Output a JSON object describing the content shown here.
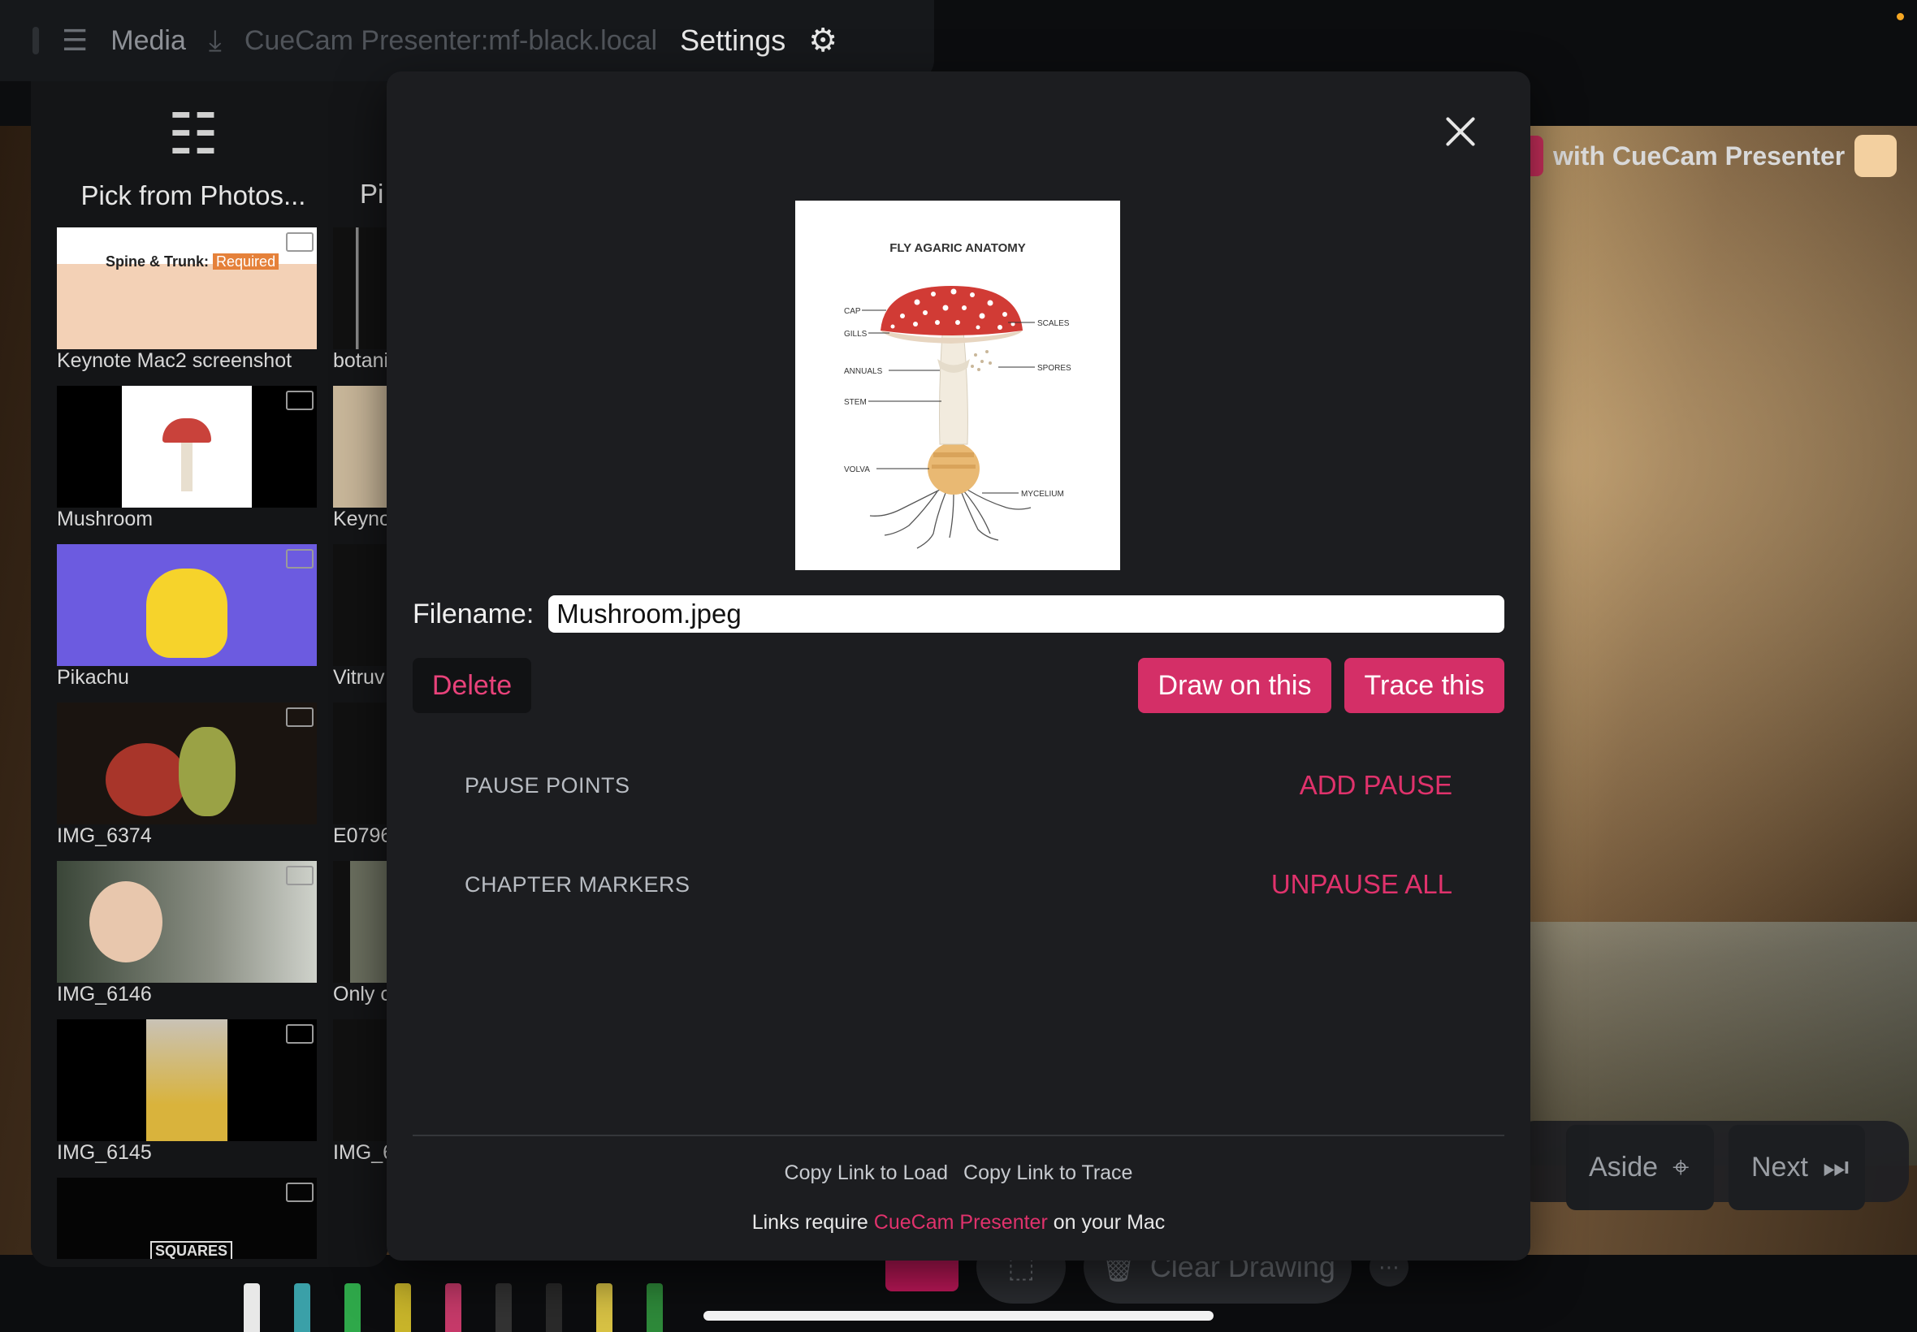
{
  "top_bar": {
    "media_label": "Media",
    "presenter_label": "CueCam Presenter:mf-black.local",
    "settings_label": "Settings"
  },
  "left_panel": {
    "pick_photos_label": "Pick from Photos...",
    "pick_other_label": "Pi",
    "col1": [
      {
        "caption": "Keynote Mac2 screenshot",
        "keynote_title": "Spine & Trunk:",
        "keynote_tag": "Required"
      },
      {
        "caption": "Mushroom"
      },
      {
        "caption": "Pikachu"
      },
      {
        "caption": "IMG_6374"
      },
      {
        "caption": "IMG_6146"
      },
      {
        "caption": "IMG_6145"
      },
      {
        "caption": "",
        "logo": "SQUARES"
      }
    ],
    "col2": [
      {
        "caption": "botani"
      },
      {
        "caption": "Keyno"
      },
      {
        "caption": "Vitruv"
      },
      {
        "caption": "E0796"
      },
      {
        "caption": "Only c"
      },
      {
        "caption": "IMG_6"
      }
    ]
  },
  "right_overlay": {
    "banner_text": "with CueCam Presenter",
    "aside_label": "Aside",
    "next_label": "Next",
    "clear_drawing_label": "Clear Drawing"
  },
  "modal": {
    "preview": {
      "title": "FLY AGARIC ANATOMY",
      "labels": {
        "cap": "CAP",
        "gills": "GILLS",
        "annuals": "ANNUALS",
        "stem": "STEM",
        "volva": "VOLVA",
        "scales": "SCALES",
        "spores": "SPORES",
        "mycelium": "MYCELIUM"
      }
    },
    "filename_label": "Filename:",
    "filename_value": "Mushroom.jpeg",
    "delete_label": "Delete",
    "draw_label": "Draw on this",
    "trace_label": "Trace this",
    "pause_points_label": "PAUSE POINTS",
    "add_pause_label": "ADD PAUSE",
    "chapter_markers_label": "CHAPTER MARKERS",
    "unpause_all_label": "UNPAUSE ALL",
    "copy_link_load_label": "Copy Link to Load",
    "copy_link_trace_label": "Copy Link to Trace",
    "links_note_prefix": "Links require",
    "links_note_app": "CueCam Presenter",
    "links_note_suffix": "on your Mac"
  },
  "colors": {
    "accent": "#d42f67",
    "modal_bg": "#1c1d20",
    "page_bg": "#0c0d0f"
  }
}
